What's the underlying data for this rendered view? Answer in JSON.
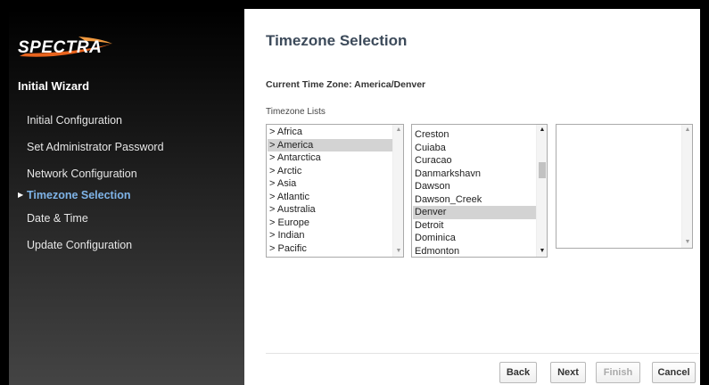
{
  "sidebar": {
    "logo_text": "SPECTRA",
    "wizard_title": "Initial Wizard",
    "items": [
      {
        "label": "Initial Configuration"
      },
      {
        "label": "Set Administrator Password"
      },
      {
        "label": "Network Configuration"
      },
      {
        "label": "Timezone Selection",
        "active": true
      },
      {
        "label": "Date & Time"
      },
      {
        "label": "Update Configuration"
      }
    ],
    "active_arrow": "▶"
  },
  "main": {
    "title": "Timezone Selection",
    "current_timezone": "Current Time Zone: America/Denver",
    "lists_label": "Timezone Lists",
    "regions": [
      "> Africa",
      "> America",
      "> Antarctica",
      "> Arctic",
      "> Asia",
      "> Atlantic",
      "> Australia",
      "> Europe",
      "> Indian",
      "> Pacific"
    ],
    "regions_selected": "> America",
    "cities": [
      "Creston",
      "Cuiaba",
      "Curacao",
      "Danmarkshavn",
      "Dawson",
      "Dawson_Creek",
      "Denver",
      "Detroit",
      "Dominica",
      "Edmonton"
    ],
    "cities_selected": "Denver",
    "third_list": []
  },
  "buttons": {
    "back": "Back",
    "next": "Next",
    "finish": "Finish",
    "cancel": "Cancel"
  },
  "colors": {
    "active_nav": "#7fb4e8",
    "title": "#3c4a5a",
    "logo_accent": "#e8641e",
    "selected_row": "#d3d3d3"
  }
}
